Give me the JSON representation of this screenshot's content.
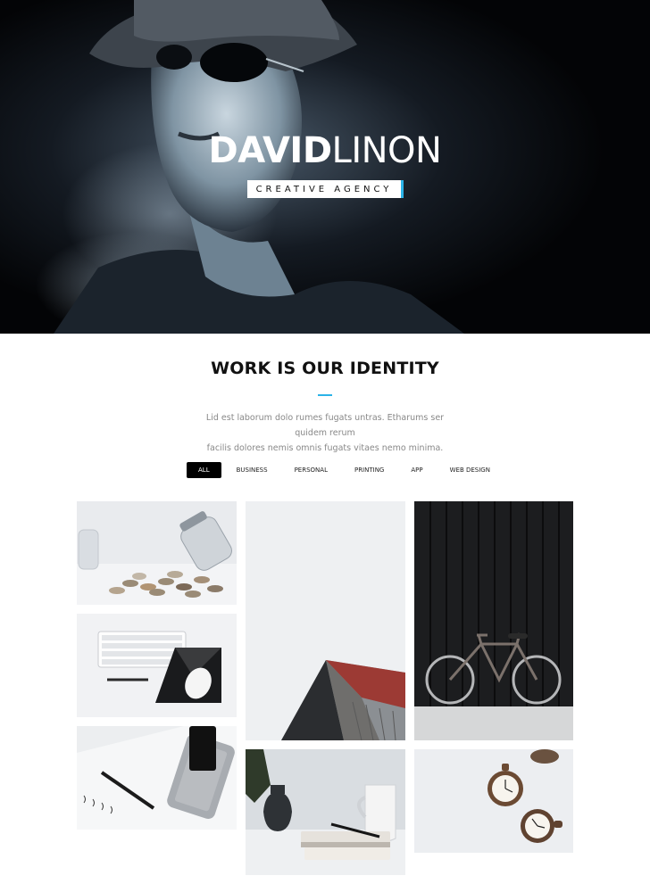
{
  "hero": {
    "title_bold": "DAVID",
    "title_light": "LINON",
    "subtitle": "CREATIVE AGENCY"
  },
  "section": {
    "title": "WORK IS OUR IDENTITY",
    "desc_line1": "Lid est laborum dolo rumes fugats untras. Etharums ser quidem rerum",
    "desc_line2": "facilis dolores nemis omnis fugats vitaes nemo minima."
  },
  "filters": [
    "ALL",
    "BUSINESS",
    "PERSONAL",
    "PRINTING",
    "APP",
    "WEB DESIGN"
  ],
  "colors": {
    "accent": "#2bb3e8",
    "active_filter_bg": "#000000"
  },
  "gallery": [
    {
      "subject": "coins-jar"
    },
    {
      "subject": "barn-roof"
    },
    {
      "subject": "bicycle-wall"
    },
    {
      "subject": "keyboard-mouse"
    },
    {
      "subject": "phone-pen"
    },
    {
      "subject": "book-vase-mug"
    },
    {
      "subject": "pocket-watches"
    }
  ]
}
